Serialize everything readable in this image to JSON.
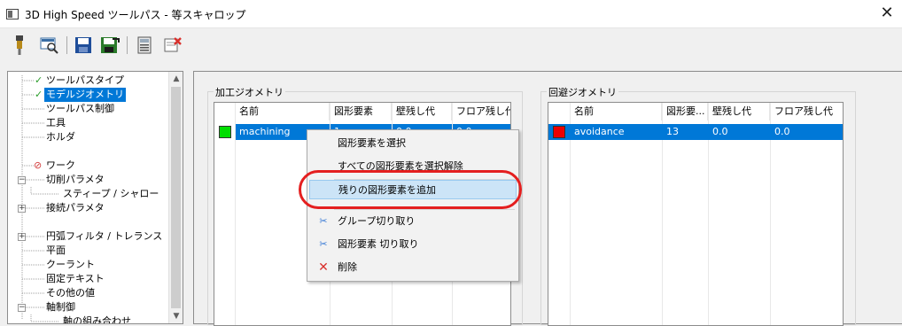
{
  "window": {
    "title": "3D High Speed ツールパス - 等スキャロップ",
    "close_glyph": "✕"
  },
  "toolbar": {
    "icons": [
      "tool-icon",
      "preview-icon",
      "save-icon",
      "save-as-icon",
      "calculator-icon",
      "delete-icon"
    ]
  },
  "tree": {
    "items": [
      {
        "label": "ツールパスタイプ",
        "status": "check"
      },
      {
        "label": "モデルジオメトリ",
        "status": "check",
        "selected": true
      },
      {
        "label": "ツールパス制御"
      },
      {
        "label": "工具"
      },
      {
        "label": "ホルダ"
      },
      {
        "label": "ワーク",
        "status": "error"
      },
      {
        "label": "切削パラメタ",
        "expander": "−"
      },
      {
        "label": "スティープ / シャロー"
      },
      {
        "label": "接続パラメタ",
        "expander": "+"
      },
      {
        "label": "円弧フィルタ / トレランス",
        "expander": "+"
      },
      {
        "label": "平面"
      },
      {
        "label": "クーラント"
      },
      {
        "label": "固定テキスト"
      },
      {
        "label": "その他の値"
      },
      {
        "label": "軸制御",
        "expander": "−"
      },
      {
        "label": "軸の組み合わせ"
      }
    ]
  },
  "machining_geometry": {
    "title": "加工ジオメトリ",
    "columns": [
      "名前",
      "図形要素",
      "壁残し代",
      "フロア残し代"
    ],
    "rows": [
      {
        "color": "#00dd00",
        "name": "machining",
        "elements": "1",
        "wall": "0.0",
        "floor": "0.0"
      }
    ]
  },
  "avoidance_geometry": {
    "title": "回避ジオメトリ",
    "columns": [
      "名前",
      "図形要...",
      "壁残し代",
      "フロア残し代"
    ],
    "rows": [
      {
        "color": "#ee0000",
        "name": "avoidance",
        "elements": "13",
        "wall": "0.0",
        "floor": "0.0"
      }
    ]
  },
  "context_menu": {
    "select_elements": "図形要素を選択",
    "deselect_all": "すべての図形要素を選択解除",
    "add_remaining": "残りの図形要素を追加",
    "group_cut": "グループ切り取り",
    "element_cut": "図形要素 切り取り",
    "delete": "削除"
  },
  "colors": {
    "selection": "#0078d7",
    "highlight": "#cce4f7",
    "annotation_ring": "#e41f1f"
  }
}
